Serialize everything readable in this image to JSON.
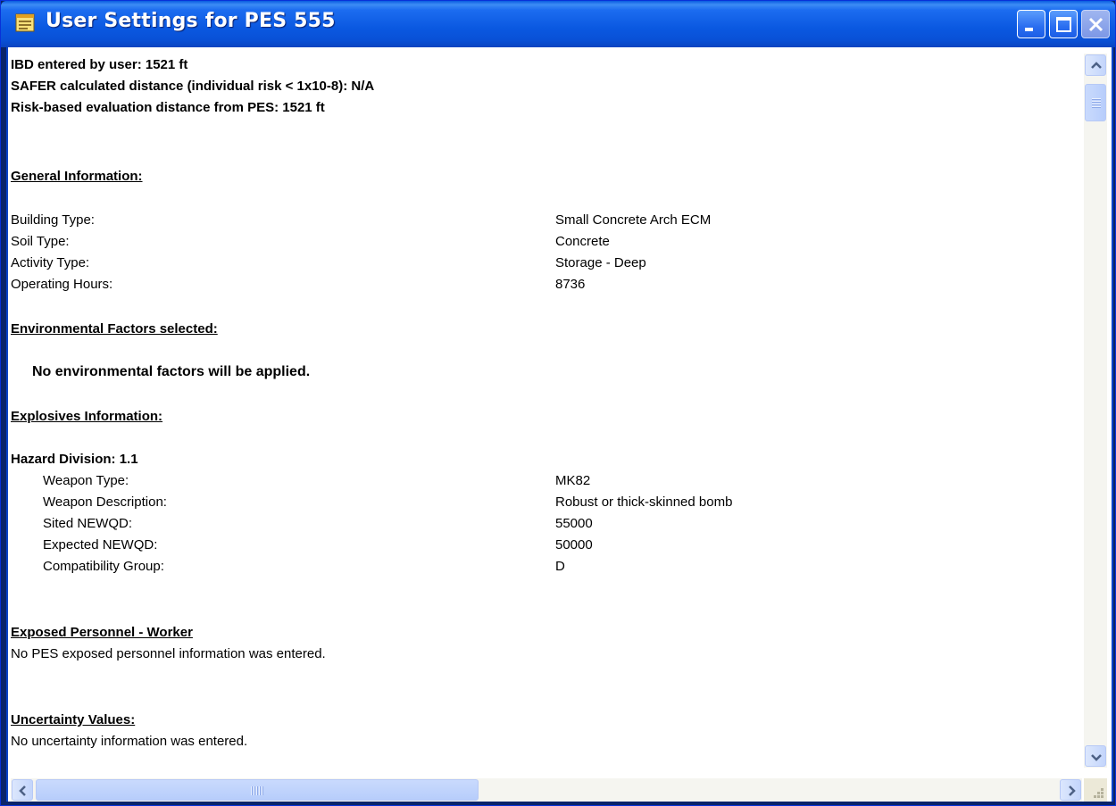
{
  "window": {
    "title": "User Settings for PES 555"
  },
  "summary": {
    "ibd": "IBD entered by user: 1521 ft",
    "safer": "SAFER calculated distance (individual risk < 1x10-8): N/A",
    "risk": "Risk-based evaluation distance from PES: 1521 ft"
  },
  "general": {
    "heading": "General Information:",
    "rows": [
      {
        "label": "Building Type:",
        "value": "Small Concrete Arch ECM"
      },
      {
        "label": "Soil Type:",
        "value": "Concrete"
      },
      {
        "label": "Activity Type:",
        "value": "Storage - Deep"
      },
      {
        "label": "Operating Hours:",
        "value": "8736"
      }
    ]
  },
  "environmental": {
    "heading": "Environmental Factors selected:",
    "note": "No environmental factors will be applied."
  },
  "explosives": {
    "heading": "Explosives Information:",
    "hazard_division": "Hazard Division: 1.1",
    "rows": [
      {
        "label": "Weapon Type:",
        "value": "MK82"
      },
      {
        "label": "Weapon Description:",
        "value": "Robust or thick-skinned bomb"
      },
      {
        "label": "Sited NEWQD:",
        "value": "55000"
      },
      {
        "label": "Expected NEWQD:",
        "value": "50000"
      },
      {
        "label": "Compatibility Group:",
        "value": "D"
      }
    ]
  },
  "exposed": {
    "heading": "Exposed Personnel - Worker",
    "note": "No PES exposed personnel information was entered."
  },
  "uncertainty": {
    "heading": "Uncertainty Values:",
    "note": "No uncertainty information was entered."
  },
  "icons": {
    "title_icon": "report-icon",
    "minimize": "minimize-icon",
    "maximize": "maximize-icon",
    "close": "close-icon",
    "scroll_up": "arrow-up-icon",
    "scroll_down": "arrow-down-icon",
    "scroll_left": "arrow-left-icon",
    "scroll_right": "arrow-right-icon"
  },
  "colors": {
    "titlebar": "#0a58e0",
    "title_text": "#ffffff",
    "content_bg": "#ffffff",
    "text": "#000000"
  }
}
